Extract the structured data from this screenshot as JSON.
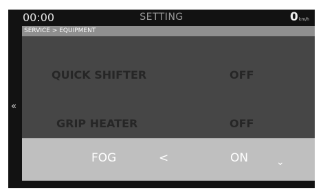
{
  "status": {
    "time": "00:00",
    "title": "SETTING",
    "speed": "0",
    "speed_unit": "km/h"
  },
  "breadcrumb": "SERVICE > EQUIPMENT",
  "menu": {
    "items": [
      {
        "label": "QUICK SHIFTER",
        "value": "OFF"
      },
      {
        "label": "GRIP HEATER",
        "value": "OFF"
      }
    ],
    "selected": {
      "label": "FOG",
      "prev_glyph": "<",
      "value": "ON",
      "next_glyph": "⌄"
    }
  },
  "nav": {
    "back_glyph": "«"
  },
  "colors": {
    "screen_bg": "#121212",
    "breadcrumb_bg": "#8f8f8f",
    "menu_bg": "#464646",
    "selected_bg": "#bfbfbf"
  }
}
